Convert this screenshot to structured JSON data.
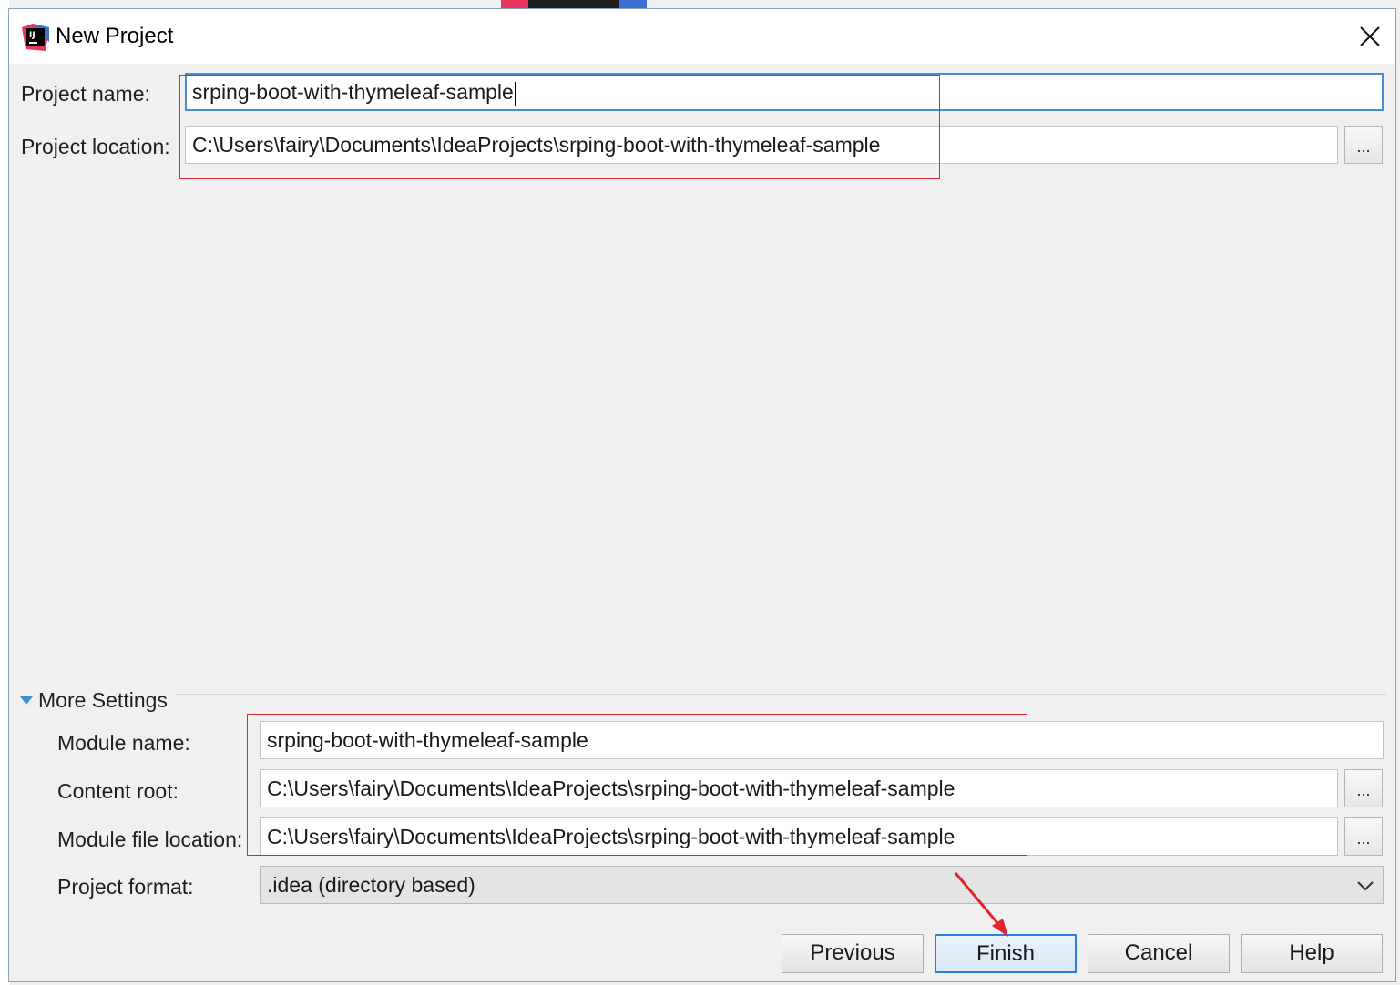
{
  "window": {
    "title": "New Project",
    "close_icon": "close-icon",
    "app_icon": "intellij-idea-icon"
  },
  "project": {
    "name_label": "Project name:",
    "name_value": "srping-boot-with-thymeleaf-sample",
    "location_label": "Project location:",
    "location_value": "C:\\Users\\fairy\\Documents\\IdeaProjects\\srping-boot-with-thymeleaf-sample",
    "browse_label": "..."
  },
  "more_settings": {
    "toggle_label": "More Settings",
    "module_name_label": "Module name:",
    "module_name_value": "srping-boot-with-thymeleaf-sample",
    "content_root_label": "Content root:",
    "content_root_value": "C:\\Users\\fairy\\Documents\\IdeaProjects\\srping-boot-with-thymeleaf-sample",
    "module_file_label": "Module file location:",
    "module_file_value": "C:\\Users\\fairy\\Documents\\IdeaProjects\\srping-boot-with-thymeleaf-sample",
    "format_label": "Project format:",
    "format_value": ".idea (directory based)",
    "browse_label": "..."
  },
  "buttons": {
    "previous": "Previous",
    "finish": "Finish",
    "cancel": "Cancel",
    "help": "Help"
  },
  "colors": {
    "annotation": "#e0262b",
    "focus": "#4a8dd0",
    "accent": "#2a7fd6"
  }
}
